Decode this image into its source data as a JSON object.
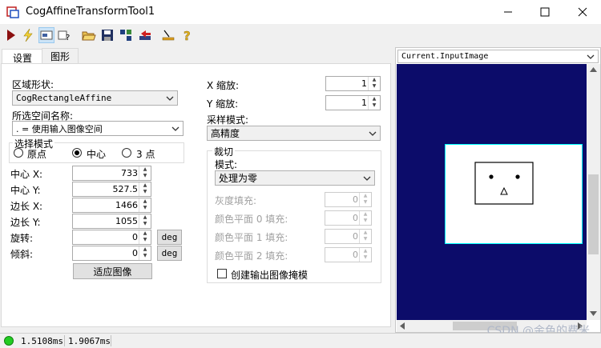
{
  "window": {
    "title": "CogAffineTransformTool1"
  },
  "tabs": [
    "设置",
    "图形"
  ],
  "region": {
    "shape_label": "区域形状:",
    "shape_value": "CogRectangleAffine",
    "space_label": "所选空间名称:",
    "space_value": ". = 使用输入图像空间"
  },
  "mode": {
    "label": "选择模式",
    "options": [
      "原点",
      "中心",
      "3 点"
    ],
    "selected": "中心"
  },
  "params": [
    {
      "label": "中心 X:",
      "value": "733"
    },
    {
      "label": "中心 Y:",
      "value": "527.5"
    },
    {
      "label": "边长 X:",
      "value": "1466"
    },
    {
      "label": "边长 Y:",
      "value": "1055"
    },
    {
      "label": "旋转:",
      "value": "0",
      "unit": "deg"
    },
    {
      "label": "倾斜:",
      "value": "0",
      "unit": "deg"
    }
  ],
  "fit_button": "适应图像",
  "scale": [
    {
      "label": "X 缩放:",
      "value": "1"
    },
    {
      "label": "Y 缩放:",
      "value": "1"
    }
  ],
  "sampling": {
    "label": "采样模式:",
    "value": "高精度"
  },
  "clip": {
    "group_label": "裁切",
    "mode_label": "模式:",
    "mode_value": "处理为零",
    "fills": [
      {
        "label": "灰度填充:",
        "value": "0"
      },
      {
        "label": "颜色平面 0 填充:",
        "value": "0"
      },
      {
        "label": "颜色平面 1 填充:",
        "value": "0"
      },
      {
        "label": "颜色平面 2 填充:",
        "value": "0"
      }
    ],
    "mask_checkbox": "创建输出图像掩模"
  },
  "image_panel": {
    "selector": "Current.InputImage"
  },
  "status": {
    "time1": "1.5108ms",
    "time2": "1.9067ms",
    "indicator_color": "#22cc22"
  },
  "watermark": "CSDN @金色的费米",
  "colors": {
    "image_bg": "#0c0c6a",
    "roi_outline": "#00ffff"
  }
}
